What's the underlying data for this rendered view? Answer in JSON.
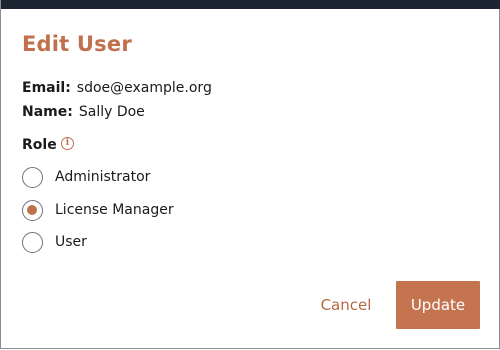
{
  "dialog": {
    "title": "Edit User",
    "email_label": "Email:",
    "email_value": "sdoe@example.org",
    "name_label": "Name:",
    "name_value": "Sally Doe",
    "role_label": "Role",
    "info_glyph": "i",
    "role_options": [
      {
        "label": "Administrator",
        "selected": false
      },
      {
        "label": "License Manager",
        "selected": true
      },
      {
        "label": "User",
        "selected": false
      }
    ],
    "cancel_label": "Cancel",
    "update_label": "Update"
  },
  "colors": {
    "accent": "#c0704d",
    "header_bar": "#1d2533",
    "button_fill": "#c47550"
  },
  "icons": {
    "role_info": "info-icon"
  }
}
